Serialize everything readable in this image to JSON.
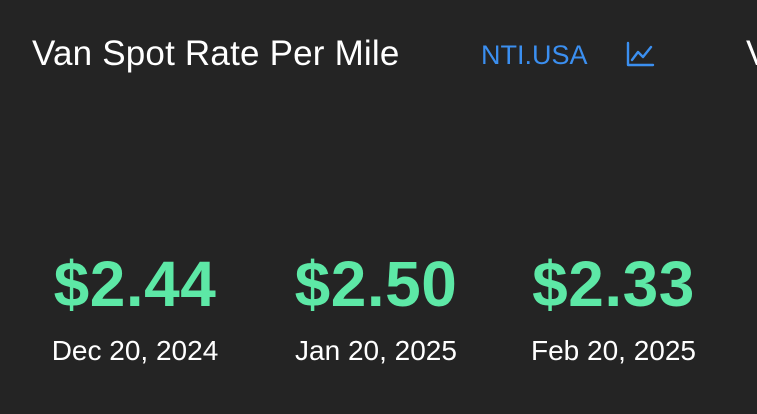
{
  "card": {
    "title": "Van Spot Rate Per Mile",
    "ticker": "NTI.USA",
    "chart_icon": "line-chart-icon",
    "next_card_peek": "V"
  },
  "accent_colors": {
    "value": "#5de8a6",
    "link": "#3b8ff0",
    "background": "#242424"
  },
  "metrics": [
    {
      "value": "$2.44",
      "date": "Dec 20, 2024"
    },
    {
      "value": "$2.50",
      "date": "Jan 20, 2025"
    },
    {
      "value": "$2.33",
      "date": "Feb 20, 2025"
    }
  ]
}
